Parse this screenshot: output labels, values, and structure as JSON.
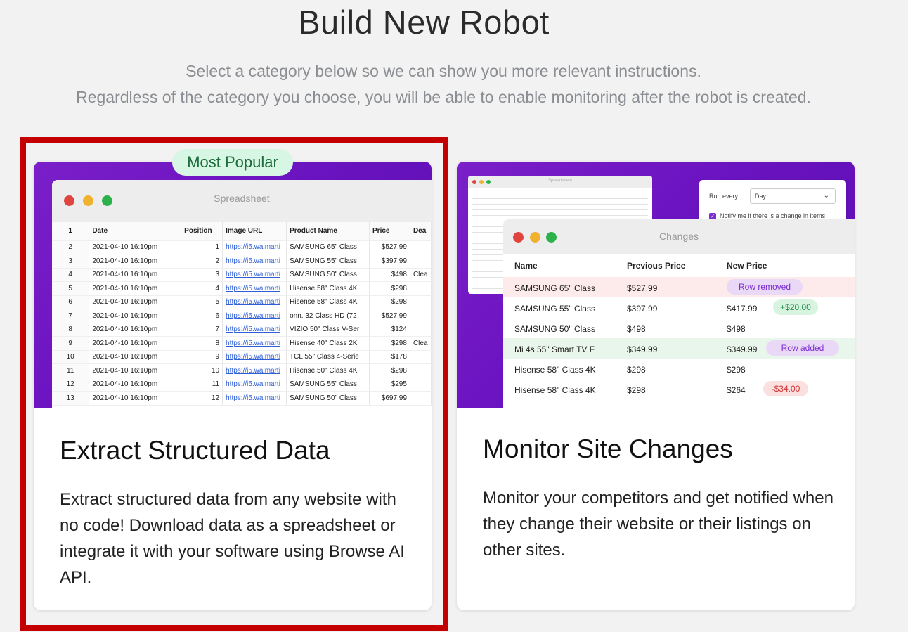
{
  "header": {
    "title": "Build New Robot",
    "subtitle_line1": "Select a category below so we can show you more relevant instructions.",
    "subtitle_line2": "Regardless of the category you choose, you will be able to enable monitoring after the robot is created."
  },
  "cards": [
    {
      "badge": "Most Popular",
      "title": "Extract Structured Data",
      "description": "Extract structured data from any website with no code! Download data as a spreadsheet or integrate it with your software using Browse AI API.",
      "highlighted": true,
      "preview": {
        "window_title": "Spreadsheet",
        "columns": [
          "1",
          "Date",
          "Position",
          "Image URL",
          "Product Name",
          "Price",
          "Dea"
        ],
        "rows": [
          [
            "2",
            "2021-04-10 16:10pm",
            "1",
            "https://i5.walmarti",
            "SAMSUNG 65\" Class",
            "$527.99",
            ""
          ],
          [
            "3",
            "2021-04-10 16:10pm",
            "2",
            "https://i5.walmarti",
            "SAMSUNG 55\" Class",
            "$397.99",
            ""
          ],
          [
            "4",
            "2021-04-10 16:10pm",
            "3",
            "https://i5.walmarti",
            "SAMSUNG 50\" Class",
            "$498",
            "Clea"
          ],
          [
            "5",
            "2021-04-10 16:10pm",
            "4",
            "https://i5.walmarti",
            "Hisense 58\" Class 4K",
            "$298",
            ""
          ],
          [
            "6",
            "2021-04-10 16:10pm",
            "5",
            "https://i5.walmarti",
            "Hisense 58\" Class 4K",
            "$298",
            ""
          ],
          [
            "7",
            "2021-04-10 16:10pm",
            "6",
            "https://i5.walmarti",
            "onn. 32 Class HD (72",
            "$527.99",
            ""
          ],
          [
            "8",
            "2021-04-10 16:10pm",
            "7",
            "https://i5.walmarti",
            "VIZIO 50\" Class V-Ser",
            "$124",
            ""
          ],
          [
            "9",
            "2021-04-10 16:10pm",
            "8",
            "https://i5.walmarti",
            "Hisense 40\" Class 2K",
            "$298",
            "Clea"
          ],
          [
            "10",
            "2021-04-10 16:10pm",
            "9",
            "https://i5.walmarti",
            "TCL 55\" Class 4-Serie",
            "$178",
            ""
          ],
          [
            "11",
            "2021-04-10 16:10pm",
            "10",
            "https://i5.walmarti",
            "Hisense 50\" Class 4K",
            "$298",
            ""
          ],
          [
            "12",
            "2021-04-10 16:10pm",
            "11",
            "https://i5.walmarti",
            "SAMSUNG 55\" Class",
            "$295",
            ""
          ],
          [
            "13",
            "2021-04-10 16:10pm",
            "12",
            "https://i5.walmarti",
            "SAMSUNG 50\" Class",
            "$697.99",
            ""
          ]
        ]
      }
    },
    {
      "title": "Monitor Site Changes",
      "description": "Monitor your competitors and get notified when they change their website or their listings on other sites.",
      "highlighted": false,
      "preview": {
        "mini_title": "Spreadsheet",
        "run_every_label": "Run every:",
        "run_every_value": "Day",
        "notify_label": "Notify me if there is a change in items",
        "window_title": "Changes",
        "columns": [
          "Name",
          "Previous Price",
          "New Price"
        ],
        "rows": [
          {
            "name": "SAMSUNG 65\" Class",
            "prev": "$527.99",
            "new": "",
            "pill": "Row removed",
            "pill_kind": "removed",
            "row_bg": "#fdeaea"
          },
          {
            "name": "SAMSUNG 55\" Class",
            "prev": "$397.99",
            "new": "$417.99",
            "pill": "+$20.00",
            "pill_kind": "up",
            "row_bg": "#ffffff"
          },
          {
            "name": "SAMSUNG 50\" Class",
            "prev": "$498",
            "new": "$498",
            "pill": "",
            "pill_kind": "",
            "row_bg": "#ffffff"
          },
          {
            "name": "Mi 4s 55\" Smart TV F",
            "prev": "$349.99",
            "new": "$349.99",
            "pill": "Row added",
            "pill_kind": "added",
            "row_bg": "#e9f6ec"
          },
          {
            "name": "Hisense 58\" Class 4K",
            "prev": "$298",
            "new": "$298",
            "pill": "",
            "pill_kind": "",
            "row_bg": "#ffffff"
          },
          {
            "name": "Hisense 58\" Class 4K",
            "prev": "$298",
            "new": "$264",
            "pill": "-$34.00",
            "pill_kind": "down",
            "row_bg": "#ffffff"
          }
        ]
      }
    }
  ],
  "colors": {
    "accent_purple": "#6a13c0",
    "highlight_red": "#c40000",
    "badge_green_bg": "#d8f6e4"
  }
}
